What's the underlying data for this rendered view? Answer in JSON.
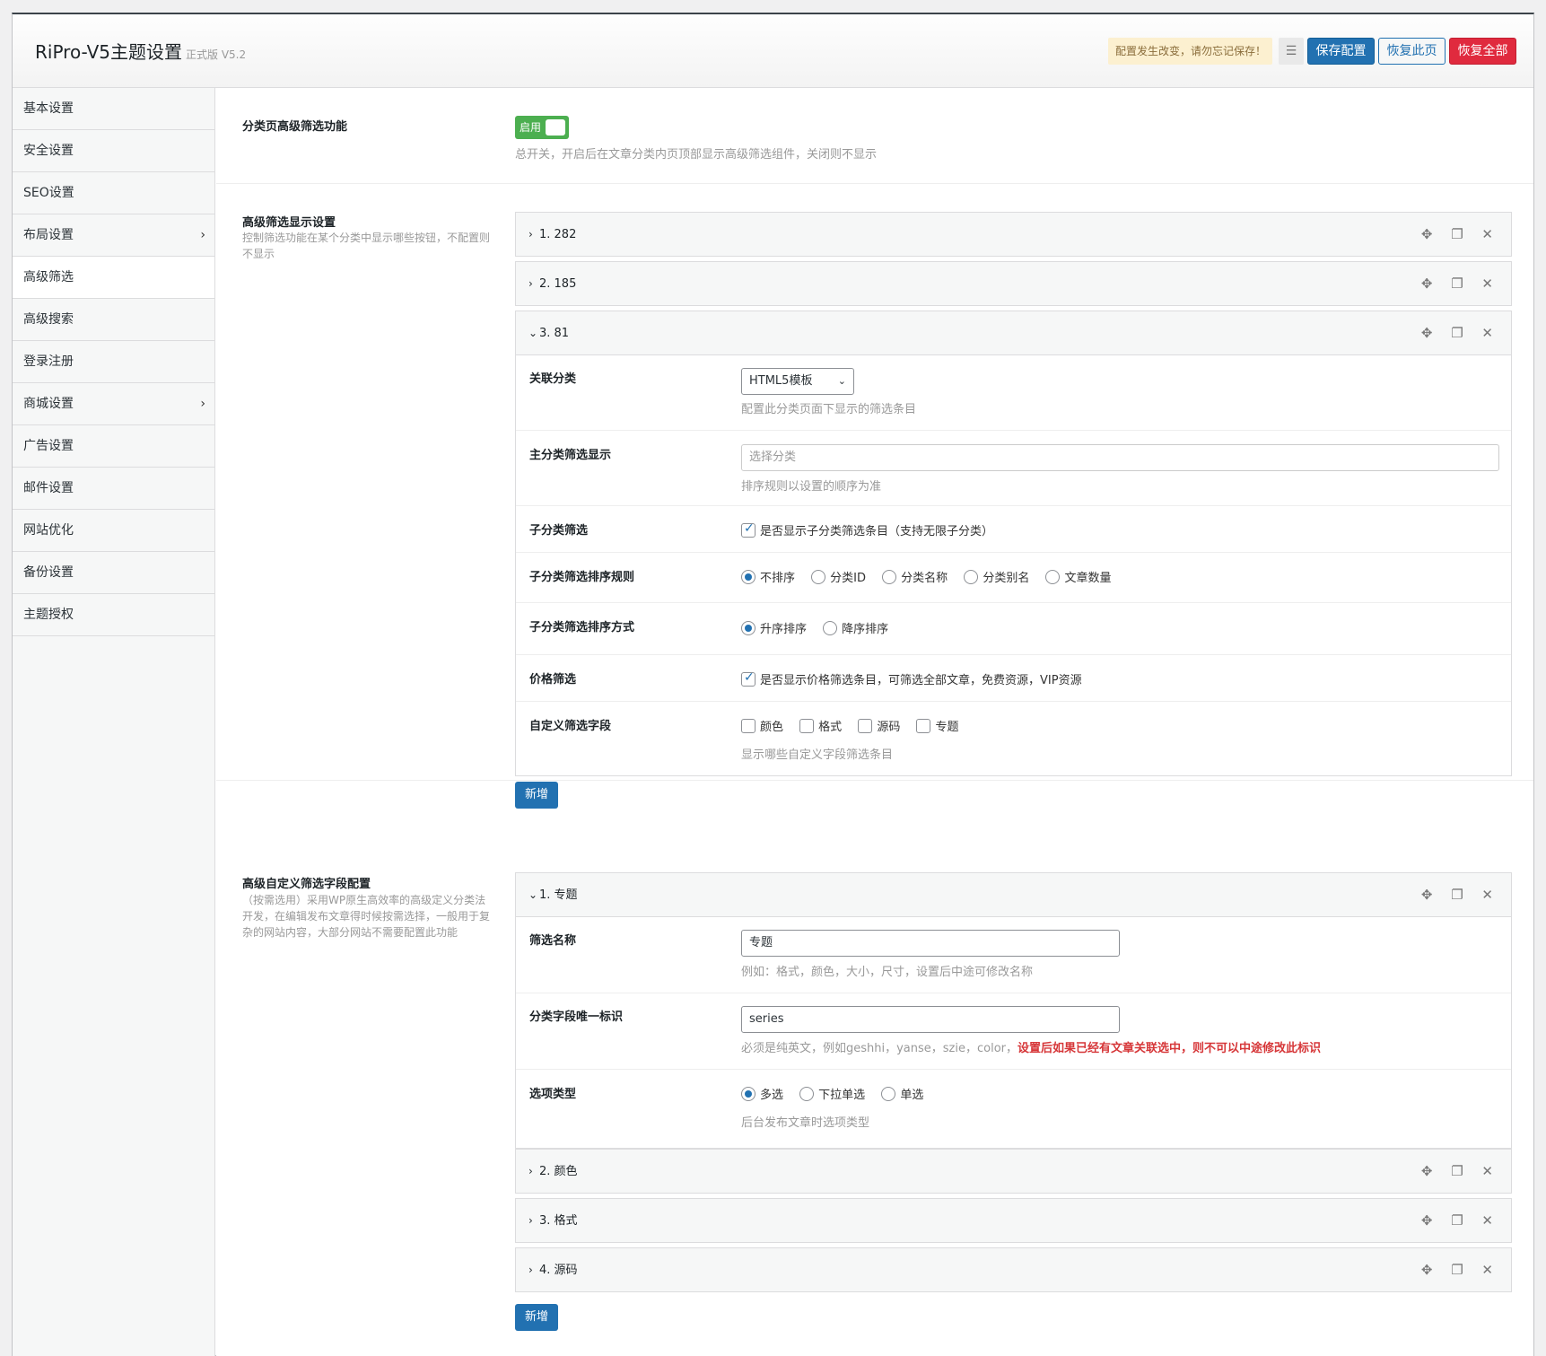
{
  "header": {
    "title": "RiPro-V5主题设置",
    "version": "正式版 V5.2",
    "notice": "配置发生改变，请勿忘记保存！",
    "expand_icon": "☰",
    "save_label": "保存配置",
    "reset_page_label": "恢复此页",
    "reset_all_label": "恢复全部"
  },
  "sidebar": {
    "items": [
      {
        "label": "基本设置"
      },
      {
        "label": "安全设置"
      },
      {
        "label": "SEO设置"
      },
      {
        "label": "布局设置",
        "chevron": "›"
      },
      {
        "label": "高级筛选"
      },
      {
        "label": "高级搜索"
      },
      {
        "label": "登录注册"
      },
      {
        "label": "商城设置",
        "chevron": "›"
      },
      {
        "label": "广告设置"
      },
      {
        "label": "邮件设置"
      },
      {
        "label": "网站优化"
      },
      {
        "label": "备份设置"
      },
      {
        "label": "主题授权"
      }
    ]
  },
  "main": {
    "switch_section": {
      "title": "分类页高级筛选功能",
      "toggle_label": "启用",
      "help": "总开关，开启后在文章分类内页顶部显示高级筛选组件，关闭则不显示"
    },
    "display_section": {
      "title": "高级筛选显示设置",
      "desc": "控制筛选功能在某个分类中显示哪些按钮，不配置则不显示",
      "items": [
        {
          "label": "1. 282",
          "arrow": "›"
        },
        {
          "label": "2. 185",
          "arrow": "›"
        },
        {
          "label": "3. 81",
          "arrow": "⌄"
        }
      ],
      "tools": "✥ ❐ ✕",
      "expanded": {
        "category": {
          "label": "关联分类",
          "value": "HTML5模板",
          "caret": "⌄",
          "help": "配置此分类页面下显示的筛选条目"
        },
        "main_cat": {
          "label": "主分类筛选显示",
          "placeholder": "选择分类",
          "help": "排序规则以设置的顺序为准"
        },
        "sub_cat": {
          "label": "子分类筛选",
          "checkbox": "是否显示子分类筛选条目（支持无限子分类）"
        },
        "sort_rule": {
          "label": "子分类筛选排序规则",
          "options": [
            "不排序",
            "分类ID",
            "分类名称",
            "分类别名",
            "文章数量"
          ]
        },
        "sort_order": {
          "label": "子分类筛选排序方式",
          "options": [
            "升序排序",
            "降序排序"
          ]
        },
        "price": {
          "label": "价格筛选",
          "checkbox": "是否显示价格筛选条目，可筛选全部文章，免费资源，VIP资源"
        },
        "custom": {
          "label": "自定义筛选字段",
          "options": [
            "颜色",
            "格式",
            "源码",
            "专题"
          ],
          "help": "显示哪些自定义字段筛选条目"
        }
      },
      "add_label": "新增"
    },
    "custom_section": {
      "title": "高级自定义筛选字段配置",
      "desc": "（按需选用）采用WP原生高效率的高级定义分类法开发，在编辑发布文章得时候按需选择，一般用于复杂的网站内容，大部分网站不需要配置此功能",
      "items": [
        {
          "label": "1. 专题",
          "arrow": "⌄"
        },
        {
          "label": "2. 颜色",
          "arrow": "›"
        },
        {
          "label": "3. 格式",
          "arrow": "›"
        },
        {
          "label": "4. 源码",
          "arrow": "›"
        }
      ],
      "tools": "✥ ❐ ✕",
      "expanded": {
        "name": {
          "label": "筛选名称",
          "value": "专题",
          "help": "例如：格式，颜色，大小，尺寸，设置后中途可修改名称"
        },
        "slug": {
          "label": "分类字段唯一标识",
          "value": "series",
          "help": "必须是纯英文，例如geshhi，yanse，szie，color，",
          "warn": "设置后如果已经有文章关联选中，则不可以中途修改此标识"
        },
        "type": {
          "label": "选项类型",
          "options": [
            "多选",
            "下拉单选",
            "单选"
          ],
          "help": "后台发布文章时选项类型"
        }
      },
      "add_label": "新增"
    }
  }
}
